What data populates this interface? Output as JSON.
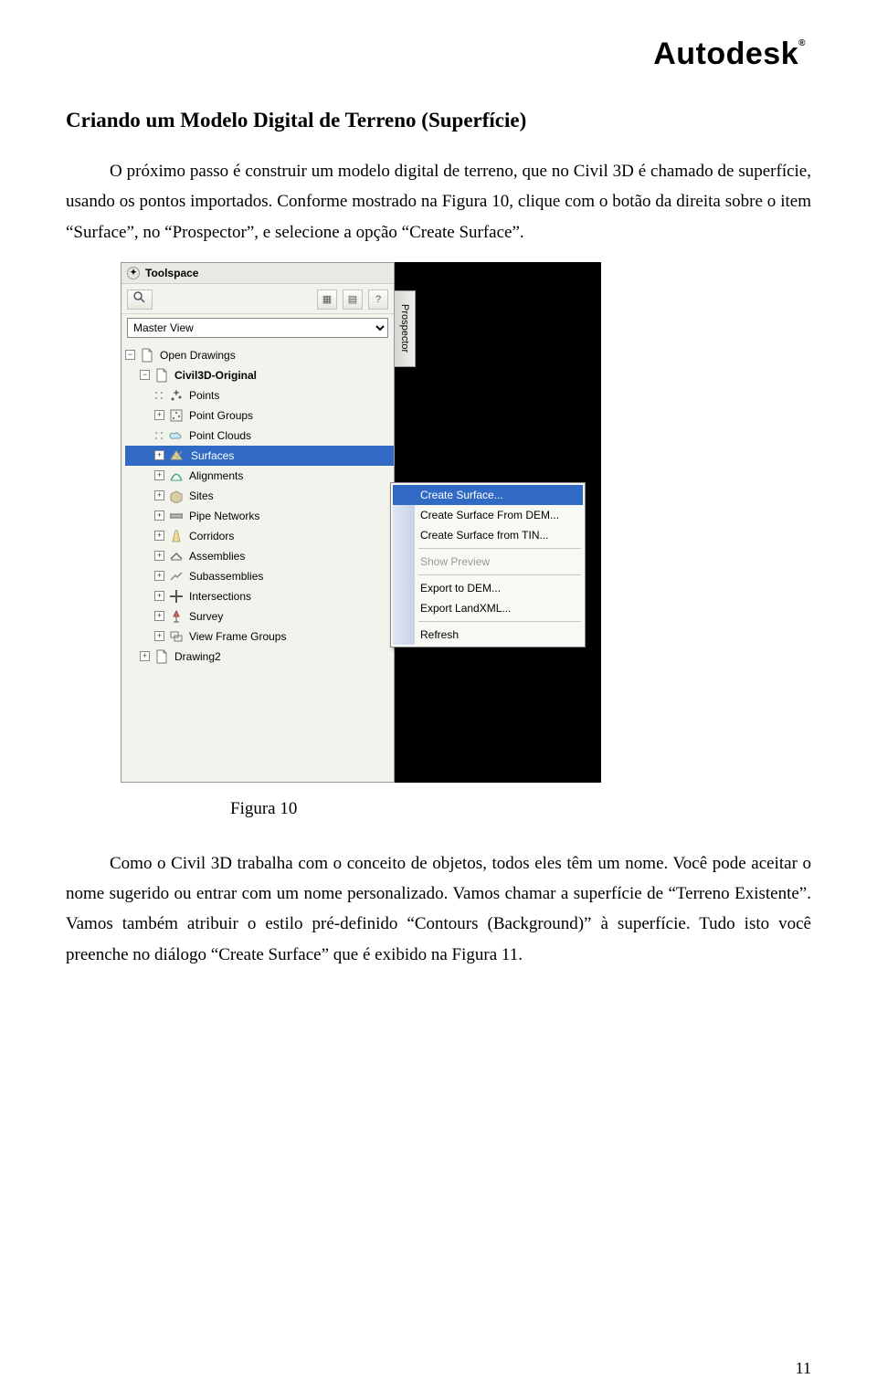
{
  "brand": "Autodesk",
  "section_title": "Criando um Modelo Digital de Terreno (Superfície)",
  "para1": "O próximo passo é construir um modelo digital de terreno, que no Civil 3D é chamado de superfície, usando os pontos importados. Conforme mostrado na Figura 10, clique com o botão da direita sobre o item “Surface”, no “Prospector”, e selecione a opção “Create Surface”.",
  "figure_caption": "Figura 10",
  "para2": "Como o Civil 3D trabalha com o conceito de objetos, todos eles têm um nome. Você pode aceitar o nome sugerido ou entrar com um nome personalizado. Vamos chamar a superfície de “Terreno Existente”. Vamos também atribuir o estilo pré-definido “Contours (Background)” à superfície. Tudo isto você preenche no diálogo “Create Surface” que é exibido na Figura 11.",
  "page_number": "11",
  "toolspace": {
    "title": "Toolspace",
    "side_tab": "Prospector",
    "dropdown_value": "Master View",
    "help_icon_label": "?",
    "tree": {
      "root": "Open Drawings",
      "drawing": "Civil3D-Original",
      "items": [
        {
          "label": "Points",
          "icon": "points"
        },
        {
          "label": "Point Groups",
          "icon": "pointgroups"
        },
        {
          "label": "Point Clouds",
          "icon": "cloud"
        },
        {
          "label": "Surfaces",
          "icon": "surface",
          "selected": true
        },
        {
          "label": "Alignments",
          "icon": "alignment"
        },
        {
          "label": "Sites",
          "icon": "sites"
        },
        {
          "label": "Pipe Networks",
          "icon": "pipes"
        },
        {
          "label": "Corridors",
          "icon": "corridor"
        },
        {
          "label": "Assemblies",
          "icon": "assembly"
        },
        {
          "label": "Subassemblies",
          "icon": "subassembly"
        },
        {
          "label": "Intersections",
          "icon": "intersection"
        },
        {
          "label": "Survey",
          "icon": "survey"
        },
        {
          "label": "View Frame Groups",
          "icon": "viewframe"
        }
      ],
      "drawing2": "Drawing2"
    }
  },
  "context_menu": {
    "items": [
      {
        "label": "Create Surface...",
        "selected": true
      },
      {
        "label": "Create Surface From DEM..."
      },
      {
        "label": "Create Surface from TIN..."
      },
      {
        "sep": true
      },
      {
        "label": "Show Preview",
        "disabled": true
      },
      {
        "sep": true
      },
      {
        "label": "Export to DEM..."
      },
      {
        "label": "Export LandXML..."
      },
      {
        "sep": true
      },
      {
        "label": "Refresh"
      }
    ]
  }
}
